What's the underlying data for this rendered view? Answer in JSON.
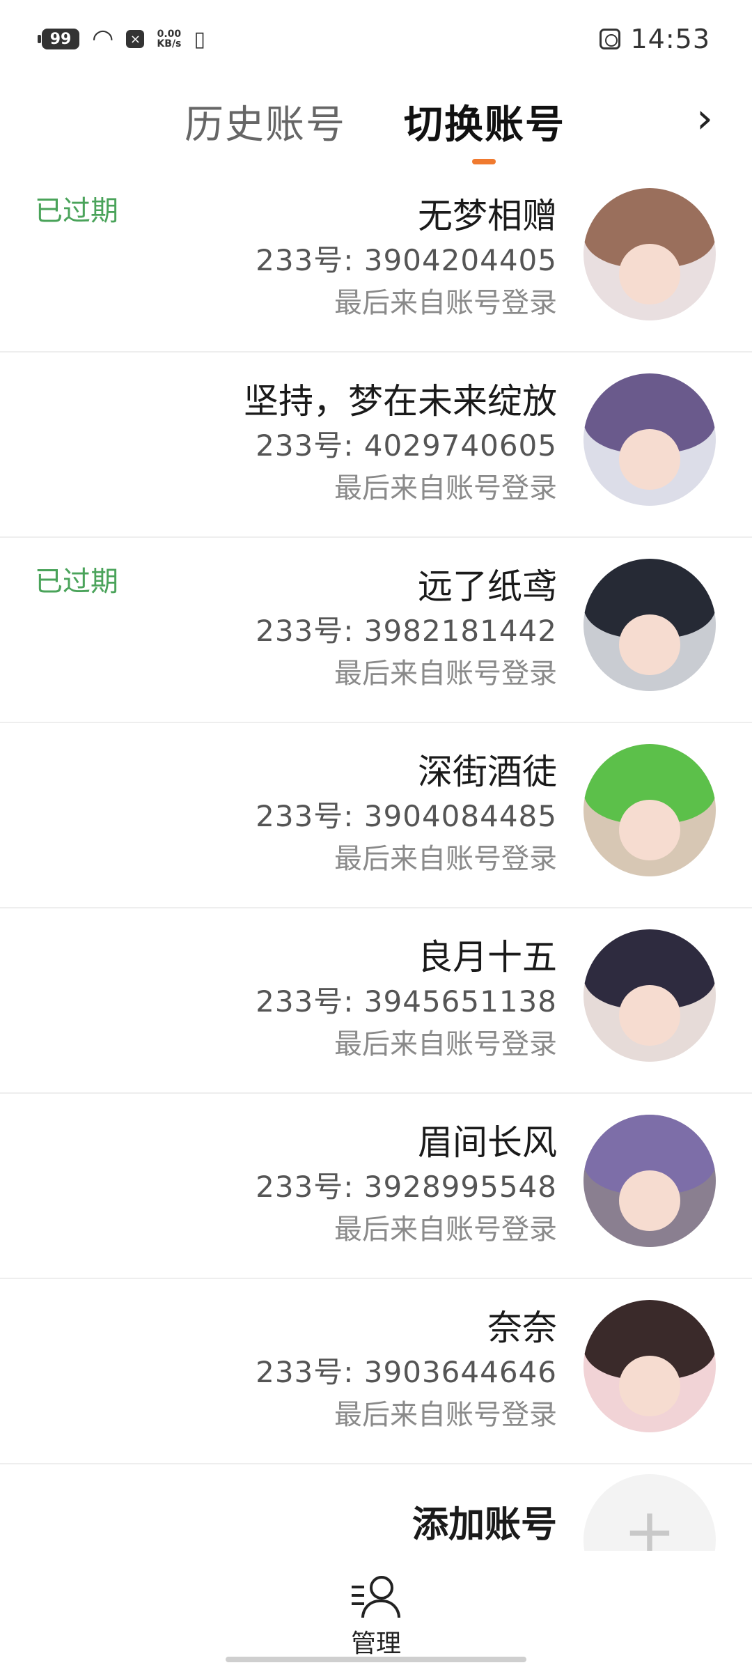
{
  "status_bar": {
    "time": "14:53",
    "battery": "99",
    "net_speed_value": "0.00",
    "net_speed_unit": "KB/s"
  },
  "header": {
    "tab_switch": "切换账号",
    "tab_history": "历史账号",
    "arrow": "›"
  },
  "accounts": [
    {
      "name": "无梦相赠",
      "uid": "233号: 3904204405",
      "last_login": "最后来自账号登录",
      "expired": "已过期"
    },
    {
      "name": "坚持，梦在未来绽放",
      "uid": "233号: 4029740605",
      "last_login": "最后来自账号登录",
      "expired": ""
    },
    {
      "name": "远了纸鸢",
      "uid": "233号: 3982181442",
      "last_login": "最后来自账号登录",
      "expired": "已过期"
    },
    {
      "name": "深街酒徒",
      "uid": "233号: 3904084485",
      "last_login": "最后来自账号登录",
      "expired": ""
    },
    {
      "name": "良月十五",
      "uid": "233号: 3945651138",
      "last_login": "最后来自账号登录",
      "expired": ""
    },
    {
      "name": "眉间长风",
      "uid": "233号: 3928995548",
      "last_login": "最后来自账号登录",
      "expired": ""
    },
    {
      "name": "奈奈",
      "uid": "233号: 3903644646",
      "last_login": "最后来自账号登录",
      "expired": ""
    }
  ],
  "add_account": {
    "label": "添加账号",
    "icon_glyph": "+"
  },
  "bottom": {
    "manage_label": "管理"
  },
  "colors": {
    "accent_indicator": "#f07a2f",
    "expired_text": "#4aa35a",
    "avatar_hair": [
      "#9a6f5c",
      "#6a5a8c",
      "#262a35",
      "#5cc04a",
      "#2e2b3f",
      "#7d6ea8",
      "#3a2a2a"
    ]
  }
}
